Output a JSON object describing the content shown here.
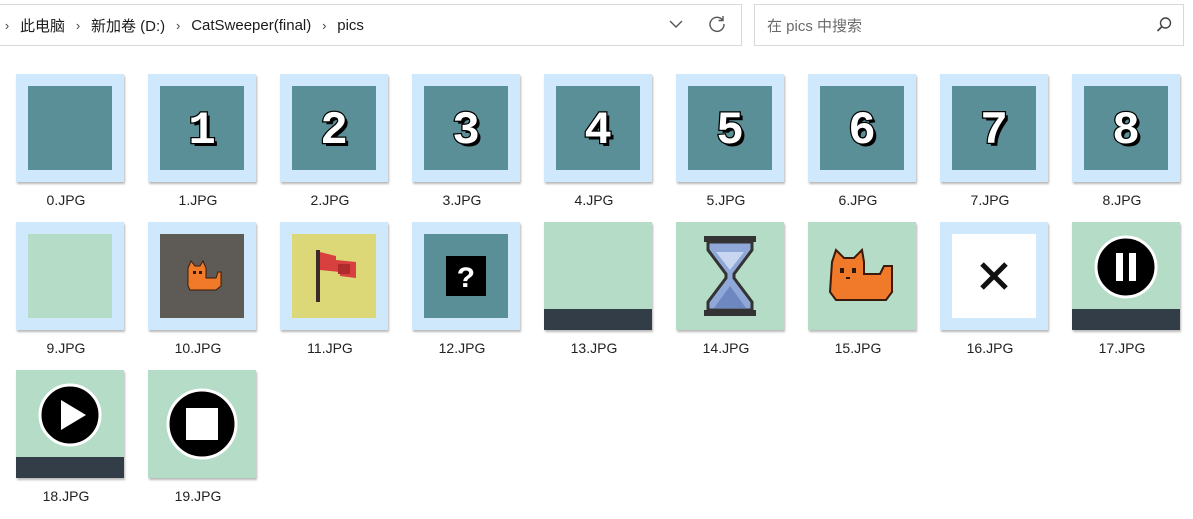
{
  "breadcrumb": {
    "items": [
      "此电脑",
      "新加卷 (D:)",
      "CatSweeper(final)",
      "pics"
    ]
  },
  "search": {
    "placeholder": "在 pics 中搜索"
  },
  "files": [
    {
      "name": "0.JPG"
    },
    {
      "name": "1.JPG"
    },
    {
      "name": "2.JPG"
    },
    {
      "name": "3.JPG"
    },
    {
      "name": "4.JPG"
    },
    {
      "name": "5.JPG"
    },
    {
      "name": "6.JPG"
    },
    {
      "name": "7.JPG"
    },
    {
      "name": "8.JPG"
    },
    {
      "name": "9.JPG"
    },
    {
      "name": "10.JPG"
    },
    {
      "name": "11.JPG"
    },
    {
      "name": "12.JPG"
    },
    {
      "name": "13.JPG"
    },
    {
      "name": "14.JPG"
    },
    {
      "name": "15.JPG"
    },
    {
      "name": "16.JPG"
    },
    {
      "name": "17.JPG"
    },
    {
      "name": "18.JPG"
    },
    {
      "name": "19.JPG"
    }
  ],
  "thumbnails": {
    "digits": [
      "1",
      "2",
      "3",
      "4",
      "5",
      "6",
      "7",
      "8"
    ],
    "question": "?"
  },
  "colors": {
    "selection_bg": "#cfe8fb",
    "teal": "#5b8f98",
    "mint": "#b4dcc6",
    "dark_bar": "#323d48",
    "cat_orange": "#f07a2a",
    "flag_red": "#d84040",
    "flag_bg": "#dcd878",
    "cat_bg": "#5e5b57"
  }
}
